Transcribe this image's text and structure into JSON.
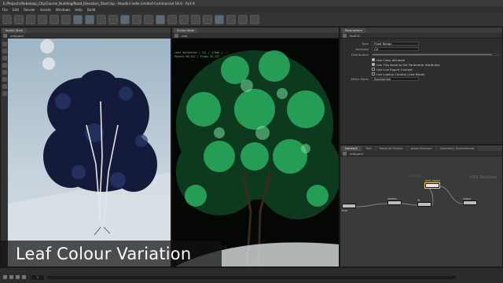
{
  "window": {
    "title": "E:/Projects/Rebeloop_City/Course_Building/Road_Elevation_Start.hip - Houdini Indie Limited-Commercial 18.0 - Py3.9"
  },
  "menu": [
    "File",
    "Edit",
    "Render",
    "Assets",
    "Windows",
    "Help",
    "Build"
  ],
  "left_viewport": {
    "tab": "Scene View",
    "path": "/obj/geo1"
  },
  "center_viewport": {
    "tab": "Scene View",
    "path": "/obj",
    "info_lines": [
      "Leaf Variation / (1) | 1/Geo | ...",
      "Points 98,412 | Prims 32,117"
    ]
  },
  "param_pane": {
    "tab": "Parameters",
    "node_name": "leafCD",
    "rows": [
      {
        "label": "Type",
        "value": "Float Range"
      },
      {
        "label": "Attribute",
        "value": "Cd"
      }
    ],
    "checks": [
      {
        "label": "Use Class Attribute",
        "checked": true
      },
      {
        "label": "Use This Node to Set Parameter Attributes",
        "checked": true
      },
      {
        "label": "Use Live Export Context",
        "checked": false
      },
      {
        "label": "Use Lookup Context (Live Mode)",
        "checked": false
      }
    ],
    "slider_label": "Distribution",
    "slider_value": 0.95,
    "dropdown_label": "Effect Mode",
    "dropdown_value": "Randomize"
  },
  "network_pane": {
    "tabs": [
      "Network",
      "Tree",
      "Material Palette",
      "Asset Browser",
      "Geometry Spreadsheet"
    ],
    "path": "/obj/geo1",
    "watermark": "VEX Builder",
    "sub_watermark": "leaf_VOP",
    "nodes": [
      {
        "label": "bind"
      },
      {
        "label": "random"
      },
      {
        "label": "fit"
      },
      {
        "label": "bind_export"
      },
      {
        "label": "output"
      }
    ]
  },
  "timeline": {
    "frame": "1"
  },
  "caption": {
    "text": "Leaf Colour Variation"
  },
  "colors": {
    "foliage_dark": "#141a3a",
    "foliage_green": "#2fbf6a",
    "accent_select": "#ffcc33"
  }
}
